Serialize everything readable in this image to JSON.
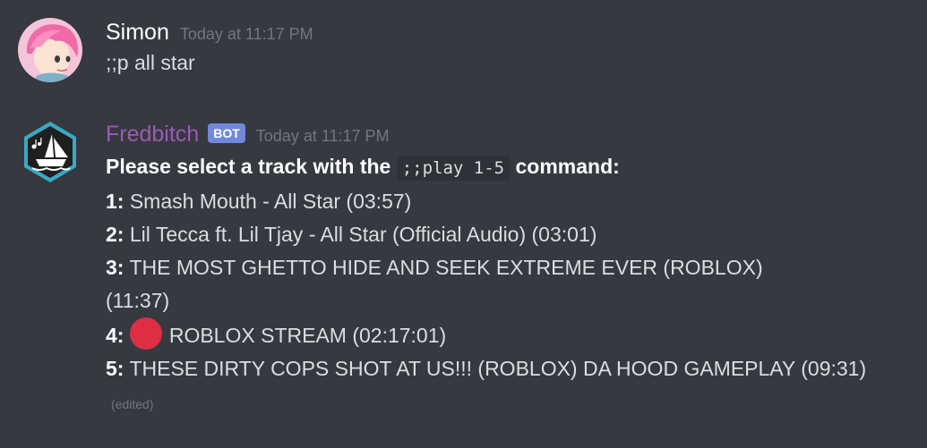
{
  "messages": [
    {
      "username": "Simon",
      "timestamp": "Today at 11:17 PM",
      "text": ";;p all star",
      "avatar_icon": "pink-hair-person-avatar"
    },
    {
      "username": "Fredbitch",
      "bot_tag": "BOT",
      "timestamp": "Today at 11:17 PM",
      "avatar_icon": "music-ship-bot-avatar",
      "intro_before": "Please select a track with the",
      "command": ";;play 1-5",
      "intro_after": "command:",
      "tracks": [
        {
          "number": "1:",
          "title": "Smash Mouth - All Star (03:57)"
        },
        {
          "number": "2:",
          "title": "Lil Tecca ft. Lil Tjay - All Star (Official Audio) (03:01)"
        },
        {
          "number": "3:",
          "title": "THE MOST GHETTO HIDE AND SEEK EXTREME EVER (ROBLOX) (11:37)"
        },
        {
          "number": "4:",
          "title": "ROBLOX STREAM (02:17:01)",
          "emoji": "red-circle-icon"
        },
        {
          "number": "5:",
          "title": "THESE DIRTY COPS SHOT AT US!!! (ROBLOX) DA HOOD GAMEPLAY (09:31)"
        }
      ],
      "edited_label": "(edited)"
    }
  ],
  "colors": {
    "background": "#36393f",
    "bot_name": "#9b59b6",
    "bot_tag": "#7289da",
    "timestamp": "#72767d",
    "red_circle": "#dd2e44"
  }
}
